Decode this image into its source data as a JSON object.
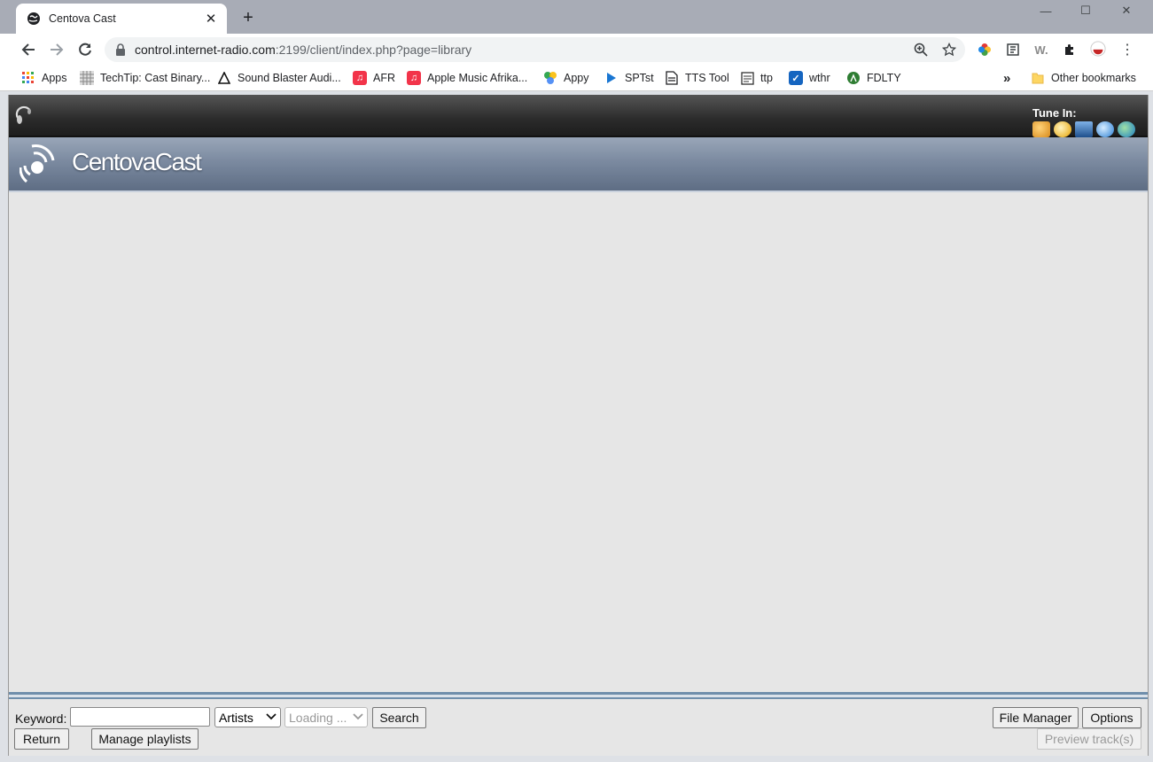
{
  "browser": {
    "tab_title": "Centova Cast",
    "tab_close": "✕",
    "new_tab": "+",
    "url_host": "control.internet-radio.com",
    "url_rest": ":2199/client/index.php?page=library",
    "window_controls": {
      "minimize": "—",
      "maximize": "☐",
      "close": "✕"
    },
    "ext_w": "W.",
    "bookmarks": [
      {
        "label": "Apps",
        "icon": "apps-grid-icon"
      },
      {
        "label": "TechTip: Cast Binary...",
        "icon": "techtip-icon"
      },
      {
        "label": "Sound Blaster Audi...",
        "icon": "sound-blaster-icon"
      },
      {
        "label": "AFR",
        "icon": "music-note-icon"
      },
      {
        "label": "Apple Music Afrika...",
        "icon": "music-note-icon"
      },
      {
        "label": "Appy",
        "icon": "appy-icon"
      },
      {
        "label": "SPTst",
        "icon": "play-triangle-icon"
      },
      {
        "label": "TTS Tool",
        "icon": "document-icon"
      },
      {
        "label": "ttp",
        "icon": "ttp-icon"
      },
      {
        "label": "wthr",
        "icon": "weather-icon"
      },
      {
        "label": "FDLTY",
        "icon": "fidelity-icon"
      }
    ],
    "bookmarks_overflow": "»",
    "other_bookmarks": "Other bookmarks"
  },
  "app": {
    "tune_in_label": "Tune In:",
    "logo_text": "CentovaCast"
  },
  "controls": {
    "keyword_label": "Keyword:",
    "keyword_value": "",
    "type_select": "Artists",
    "loading_select": "Loading ...",
    "search_button": "Search",
    "return_button": "Return",
    "manage_playlists_button": "Manage playlists",
    "file_manager_button": "File Manager",
    "options_button": "Options",
    "preview_button": "Preview track(s)"
  },
  "colors": {
    "accent_blue": "#6f8eab",
    "banner_top": "#99a6b8",
    "banner_bottom": "#5e6d84",
    "content_bg": "#e6e6e6"
  }
}
